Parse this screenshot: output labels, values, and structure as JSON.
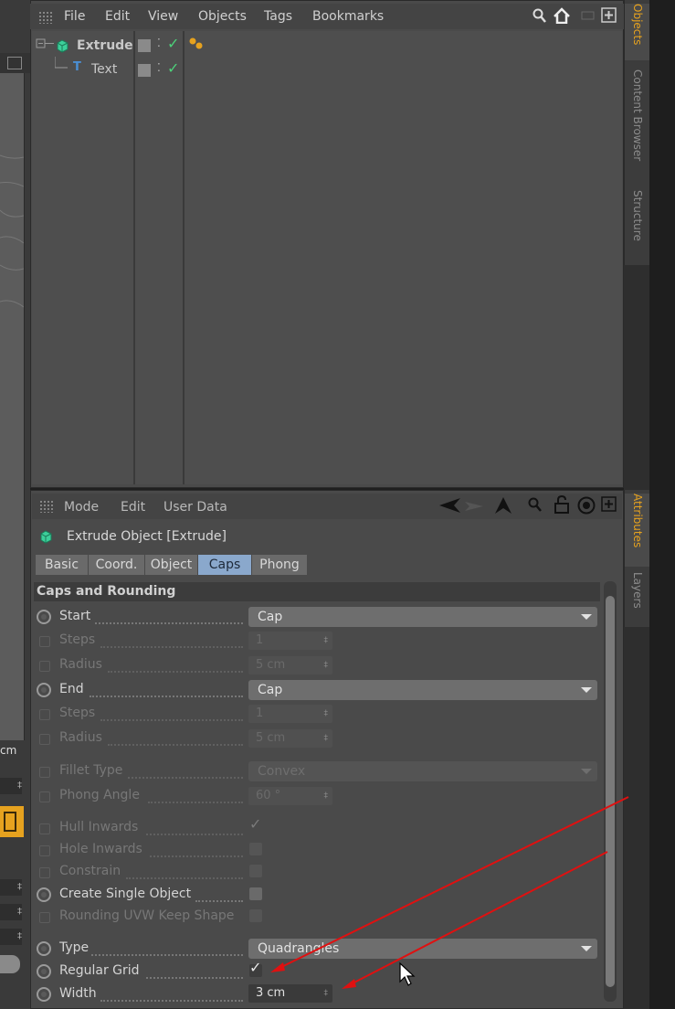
{
  "viewport": {
    "units": "cm",
    "spinners": [
      "‡",
      "‡",
      "‡",
      "‡"
    ]
  },
  "object_manager": {
    "menu": [
      "File",
      "Edit",
      "View",
      "Objects",
      "Tags",
      "Bookmarks"
    ],
    "objects": [
      {
        "name": "Extrude",
        "color": "#e6a21f"
      },
      {
        "name": "Text",
        "color": "#a87a2a"
      }
    ],
    "side_tabs": [
      "Objects",
      "Content Browser",
      "Structure"
    ]
  },
  "attribute_manager": {
    "menu": [
      "Mode",
      "Edit",
      "User Data"
    ],
    "title": "Extrude Object [Extrude]",
    "tabs": [
      "Basic",
      "Coord.",
      "Object",
      "Caps",
      "Phong"
    ],
    "active_tab": "Caps",
    "group": "Caps and Rounding",
    "side_tabs": [
      "Attributes",
      "Layers"
    ],
    "fields": {
      "start": {
        "label": "Start",
        "value": "Cap"
      },
      "steps1": {
        "label": "Steps",
        "value": "1"
      },
      "radius1": {
        "label": "Radius",
        "value": "5 cm"
      },
      "end": {
        "label": "End",
        "value": "Cap"
      },
      "steps2": {
        "label": "Steps",
        "value": "1"
      },
      "radius2": {
        "label": "Radius",
        "value": "5 cm"
      },
      "fillet_type": {
        "label": "Fillet Type",
        "value": "Convex"
      },
      "phong_angle": {
        "label": "Phong Angle",
        "value": "60 °"
      },
      "hull_inwards": {
        "label": "Hull Inwards",
        "checked": true
      },
      "hole_inwards": {
        "label": "Hole Inwards",
        "checked": false
      },
      "constrain": {
        "label": "Constrain",
        "checked": false
      },
      "create_single_object": {
        "label": "Create Single Object",
        "checked": false
      },
      "rounding_uvw": {
        "label": "Rounding UVW Keep Shape",
        "checked": false
      },
      "type": {
        "label": "Type",
        "value": "Quadrangles"
      },
      "regular_grid": {
        "label": "Regular Grid",
        "checked": true
      },
      "width": {
        "label": "Width",
        "value": "3 cm"
      }
    }
  },
  "colors": {
    "accent_orange": "#e6a21f",
    "active_tab": "#8aa8cc",
    "annotation_red": "#e01010"
  }
}
